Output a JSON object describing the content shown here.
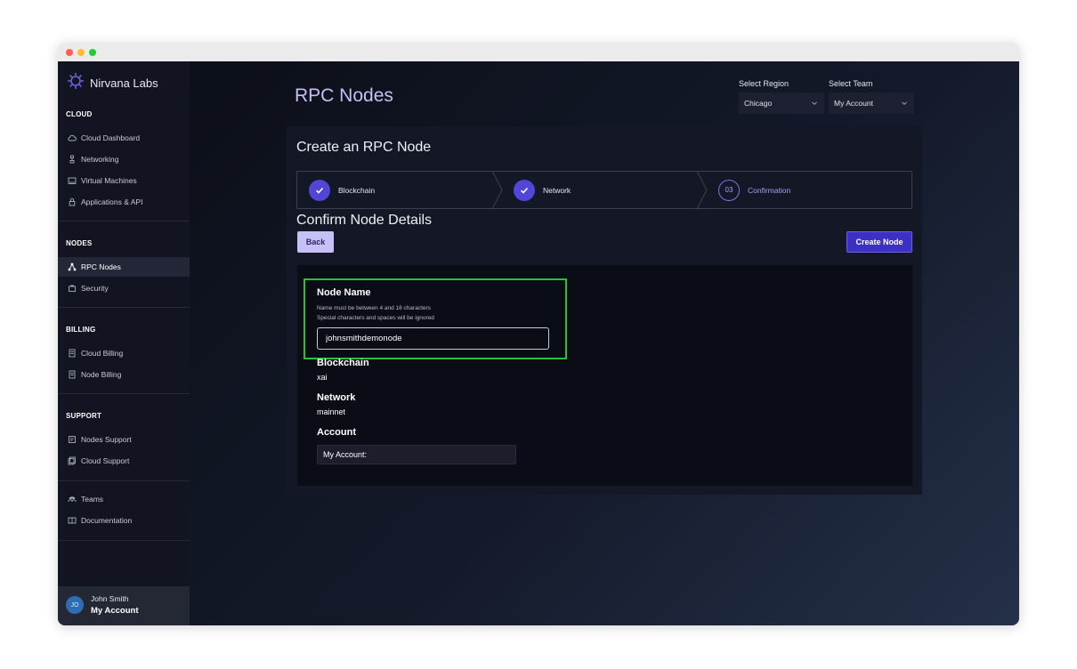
{
  "app": {
    "name": "Nirvana Labs"
  },
  "sidebar": {
    "sections": [
      {
        "title": "CLOUD",
        "items": [
          {
            "label": "Cloud Dashboard",
            "icon": "cloud-icon"
          },
          {
            "label": "Networking",
            "icon": "network-icon"
          },
          {
            "label": "Virtual Machines",
            "icon": "monitor-icon"
          },
          {
            "label": "Applications & API",
            "icon": "lock-icon"
          }
        ]
      },
      {
        "title": "NODES",
        "items": [
          {
            "label": "RPC Nodes",
            "icon": "nodes-icon",
            "active": true
          },
          {
            "label": "Security",
            "icon": "shield-icon"
          }
        ]
      },
      {
        "title": "BILLING",
        "items": [
          {
            "label": "Cloud Billing",
            "icon": "receipt-icon"
          },
          {
            "label": "Node Billing",
            "icon": "receipt-icon"
          }
        ]
      },
      {
        "title": "SUPPORT",
        "items": [
          {
            "label": "Nodes Support",
            "icon": "support-icon"
          },
          {
            "label": "Cloud Support",
            "icon": "support-icon"
          }
        ]
      },
      {
        "title": "",
        "items": [
          {
            "label": "Teams",
            "icon": "team-icon"
          },
          {
            "label": "Documentation",
            "icon": "book-icon"
          }
        ]
      }
    ],
    "user": {
      "initials": "JO",
      "name": "John Smith",
      "account": "My Account"
    }
  },
  "header": {
    "title": "RPC Nodes",
    "region": {
      "label": "Select Region",
      "value": "Chicago"
    },
    "team": {
      "label": "Select Team",
      "value": "My Account"
    }
  },
  "wizard": {
    "title": "Create an RPC Node",
    "steps": [
      {
        "label": "Blockchain",
        "status": "done"
      },
      {
        "label": "Network",
        "status": "done"
      },
      {
        "label": "Confirmation",
        "number": "03",
        "status": "current"
      }
    ],
    "section_title": "Confirm Node Details",
    "back_label": "Back",
    "create_label": "Create Node",
    "node_name": {
      "label": "Node Name",
      "hint1": "Name must be between 4 and 18 characters",
      "hint2": "Special characters and spaces will be ignored",
      "value": "johnsmithdemonode"
    },
    "blockchain": {
      "label": "Blockchain",
      "value": "xai"
    },
    "network": {
      "label": "Network",
      "value": "mainnet"
    },
    "account": {
      "label": "Account",
      "value": "My Account:"
    }
  },
  "colors": {
    "accent": "#5246d8",
    "title": "#c4c0f4",
    "highlight": "#27c13a",
    "create_button": "#3b2fc4",
    "back_button": "#c5c1f4"
  }
}
